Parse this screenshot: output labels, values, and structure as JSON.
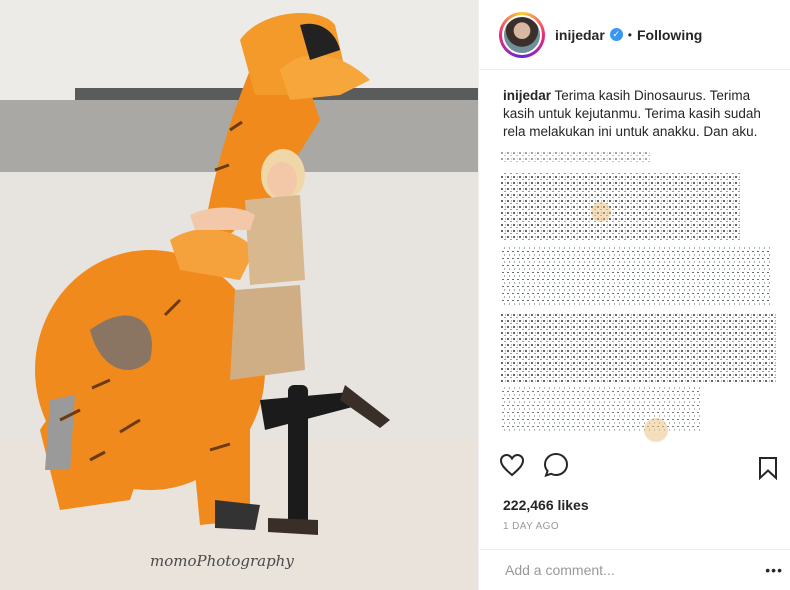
{
  "photo": {
    "watermark": "momoPhotography"
  },
  "header": {
    "username": "inijedar",
    "verified_icon": "check-icon",
    "separator": "•",
    "follow_label": "Following"
  },
  "caption": {
    "username": "inijedar",
    "text": "Terima kasih Dinosaurus. Terima kasih untuk kejutanmu. Terima kasih sudah rela melakukan ini untuk anakku. Dan aku."
  },
  "actions": {
    "like_icon": "heart-icon",
    "comment_icon": "comment-icon",
    "save_icon": "bookmark-icon"
  },
  "stats": {
    "likes": "222,466 likes",
    "time": "1 DAY AGO"
  },
  "comment": {
    "placeholder": "Add a comment...",
    "more_label": "•••"
  },
  "colors": {
    "accent": "#3897f0",
    "costume": "#f08a1c"
  }
}
